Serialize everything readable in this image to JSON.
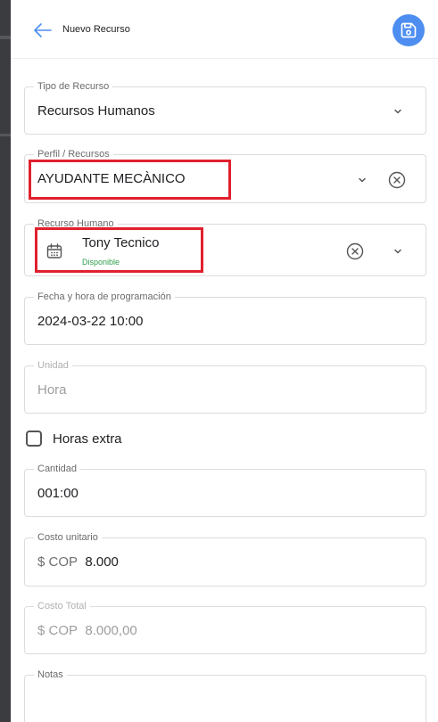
{
  "header": {
    "title": "Nuevo Recurso"
  },
  "fields": {
    "tipo_recurso": {
      "label": "Tipo de Recurso",
      "value": "Recursos Humanos"
    },
    "perfil": {
      "label": "Perfil / Recursos",
      "value": "AYUDANTE MECÀNICO"
    },
    "recurso_humano": {
      "label": "Recurso Humano",
      "name": "Tony Tecnico",
      "status": "Disponible"
    },
    "fecha_hora": {
      "label": "Fecha y hora de programación",
      "value": "2024-03-22 10:00"
    },
    "unidad": {
      "label": "Unidad",
      "value": "Hora"
    },
    "horas_extra": {
      "label": "Horas extra",
      "checked": false
    },
    "cantidad": {
      "label": "Cantidad",
      "value": "001:00"
    },
    "costo_unitario": {
      "label": "Costo unitario",
      "prefix": "$ COP",
      "value": "8.000"
    },
    "costo_total": {
      "label": "Costo Total",
      "prefix": "$ COP",
      "value": "8.000,00"
    },
    "notas": {
      "label": "Notas",
      "value": ""
    }
  },
  "colors": {
    "accent": "#4d8ef0",
    "highlight": "#e0202e",
    "status_available": "#2e9e4a"
  }
}
